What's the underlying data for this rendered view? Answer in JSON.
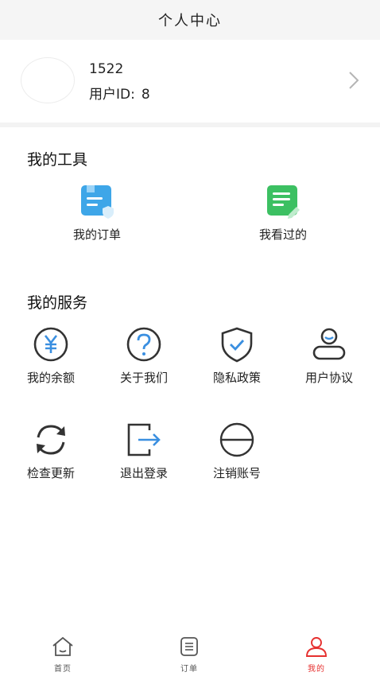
{
  "header": {
    "title": "个人中心"
  },
  "profile": {
    "name": "1522",
    "uid_label": "用户ID:",
    "uid_value": "8"
  },
  "tools": {
    "title": "我的工具",
    "items": [
      {
        "label": "我的订单",
        "icon": "order-icon"
      },
      {
        "label": "我看过的",
        "icon": "history-icon"
      }
    ]
  },
  "services": {
    "title": "我的服务",
    "items": [
      {
        "label": "我的余额",
        "icon": "yen-icon"
      },
      {
        "label": "关于我们",
        "icon": "question-icon"
      },
      {
        "label": "隐私政策",
        "icon": "shield-icon"
      },
      {
        "label": "用户协议",
        "icon": "user-icon"
      },
      {
        "label": "检查更新",
        "icon": "refresh-icon"
      },
      {
        "label": "退出登录",
        "icon": "logout-icon"
      },
      {
        "label": "注销账号",
        "icon": "minus-circle-icon"
      }
    ]
  },
  "tabbar": {
    "active_color": "#e6302f",
    "items": [
      {
        "label": "首页",
        "icon": "home-icon"
      },
      {
        "label": "订单",
        "icon": "list-icon"
      },
      {
        "label": "我的",
        "icon": "user-icon",
        "active": true
      }
    ]
  }
}
